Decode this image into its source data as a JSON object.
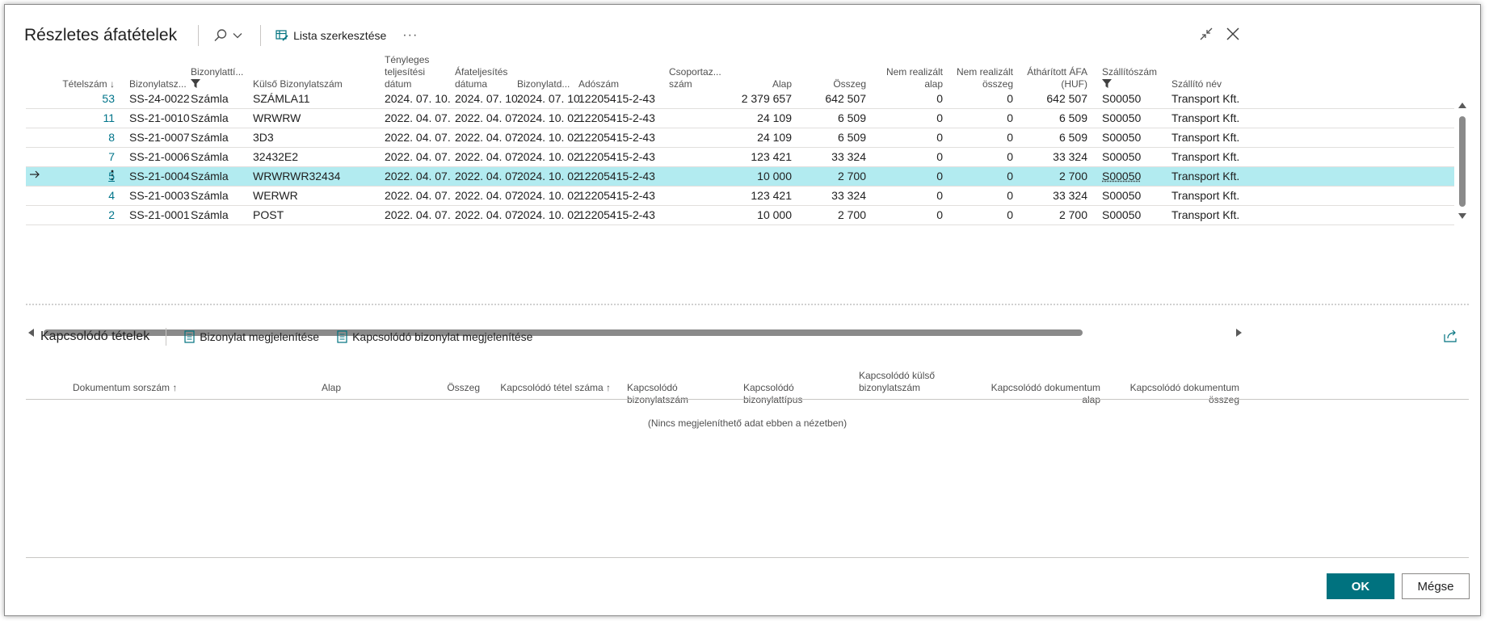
{
  "header": {
    "title": "Részletes áfatételek",
    "edit_list_label": "Lista szerkesztése",
    "more_label": "···"
  },
  "grid": {
    "columns": [
      {
        "label": "Tételszám ↓"
      },
      {
        "label": "Bizonylatsz..."
      },
      {
        "label": "Bizonylattí..."
      },
      {
        "label": "Külső Bizonylatszám"
      },
      {
        "label": "Tényleges teljesítési dátum",
        "lines": [
          "Tényleges",
          "teljesítési",
          "dátum"
        ]
      },
      {
        "label": "Áfateljesítés dátuma",
        "lines": [
          "Áfateljesítés",
          "dátuma"
        ]
      },
      {
        "label": "Bizonylatd..."
      },
      {
        "label": "Adószám"
      },
      {
        "label": "Csoportaz... szám",
        "lines": [
          "Csoportaz...",
          "szám"
        ]
      },
      {
        "label": "Alap"
      },
      {
        "label": "Összeg"
      },
      {
        "label": "Nem realizált alap",
        "lines": [
          "Nem realizált",
          "alap"
        ]
      },
      {
        "label": "Nem realizált összeg",
        "lines": [
          "Nem realizált",
          "összeg"
        ]
      },
      {
        "label": "Áthárított ÁFA (HUF)",
        "lines": [
          "Áthárított ÁFA",
          "(HUF)"
        ]
      },
      {
        "label": "Szállítószám"
      },
      {
        "label": "Szállító név"
      }
    ],
    "rows": [
      {
        "id": "53",
        "doc": "SS-24-0022",
        "type": "Számla",
        "ext": "SZÁMLA11",
        "actual": "2024. 07. 10.",
        "vatdate": "2024. 07. 10.",
        "docdate": "2024. 07. 10.",
        "tax": "12205415-2-43",
        "group": "",
        "base": "2 379 657",
        "amount": "642 507",
        "nrbase": "0",
        "nramount": "0",
        "vat": "642 507",
        "vendor": "S00050",
        "vname": "Transport Kft."
      },
      {
        "id": "11",
        "doc": "SS-21-0010",
        "type": "Számla",
        "ext": "WRWRW",
        "actual": "2022. 04. 07.",
        "vatdate": "2022. 04. 07.",
        "docdate": "2024. 10. 02.",
        "tax": "12205415-2-43",
        "group": "",
        "base": "24 109",
        "amount": "6 509",
        "nrbase": "0",
        "nramount": "0",
        "vat": "6 509",
        "vendor": "S00050",
        "vname": "Transport Kft."
      },
      {
        "id": "8",
        "doc": "SS-21-0007",
        "type": "Számla",
        "ext": "3D3",
        "actual": "2022. 04. 07.",
        "vatdate": "2022. 04. 07.",
        "docdate": "2024. 10. 02.",
        "tax": "12205415-2-43",
        "group": "",
        "base": "24 109",
        "amount": "6 509",
        "nrbase": "0",
        "nramount": "0",
        "vat": "6 509",
        "vendor": "S00050",
        "vname": "Transport Kft."
      },
      {
        "id": "7",
        "doc": "SS-21-0006",
        "type": "Számla",
        "ext": "32432E2",
        "actual": "2022. 04. 07.",
        "vatdate": "2022. 04. 07.",
        "docdate": "2024. 10. 02.",
        "tax": "12205415-2-43",
        "group": "",
        "base": "123 421",
        "amount": "33 324",
        "nrbase": "0",
        "nramount": "0",
        "vat": "33 324",
        "vendor": "S00050",
        "vname": "Transport Kft."
      },
      {
        "id": "5",
        "doc": "SS-21-0004",
        "type": "Számla",
        "ext": "WRWRWR32434",
        "actual": "2022. 04. 07.",
        "vatdate": "2022. 04. 07.",
        "docdate": "2024. 10. 02.",
        "tax": "12205415-2-43",
        "group": "",
        "base": "10 000",
        "amount": "2 700",
        "nrbase": "0",
        "nramount": "0",
        "vat": "2 700",
        "vendor": "S00050",
        "vname": "Transport Kft.",
        "selected": true
      },
      {
        "id": "4",
        "doc": "SS-21-0003",
        "type": "Számla",
        "ext": "WERWR",
        "actual": "2022. 04. 07.",
        "vatdate": "2022. 04. 07.",
        "docdate": "2024. 10. 02.",
        "tax": "12205415-2-43",
        "group": "",
        "base": "123 421",
        "amount": "33 324",
        "nrbase": "0",
        "nramount": "0",
        "vat": "33 324",
        "vendor": "S00050",
        "vname": "Transport Kft."
      },
      {
        "id": "2",
        "doc": "SS-21-0001",
        "type": "Számla",
        "ext": "POST",
        "actual": "2022. 04. 07.",
        "vatdate": "2022. 04. 07.",
        "docdate": "2024. 10. 02.",
        "tax": "12205415-2-43",
        "group": "",
        "base": "10 000",
        "amount": "2 700",
        "nrbase": "0",
        "nramount": "0",
        "vat": "2 700",
        "vendor": "S00050",
        "vname": "Transport Kft."
      }
    ]
  },
  "subpage": {
    "title": "Kapcsolódó tételek",
    "show_doc_label": "Bizonylat megjelenítése",
    "show_related_doc_label": "Kapcsolódó bizonylat megjelenítése",
    "columns": [
      {
        "label": "Dokumentum sorszám ↑"
      },
      {
        "label": "Alap"
      },
      {
        "label": "Összeg"
      },
      {
        "label": "Kapcsolódó tétel száma ↑"
      },
      {
        "label": "Kapcsolódó bizonylatszám"
      },
      {
        "label": "Kapcsolódó bizonylattípus"
      },
      {
        "label": "Kapcsolódó külső bizonylatszám",
        "lines": [
          "Kapcsolódó külső",
          "bizonylatszám"
        ]
      },
      {
        "label": "Kapcsolódó dokumentum alap"
      },
      {
        "label": "Kapcsolódó dokumentum összeg"
      }
    ],
    "empty_text": "(Nincs megjeleníthető adat ebben a nézetben)"
  },
  "footer": {
    "ok_label": "OK",
    "cancel_label": "Mégse"
  },
  "colors": {
    "accent": "#00727f",
    "link": "#00748a",
    "selected_row": "#b2ebf0"
  }
}
